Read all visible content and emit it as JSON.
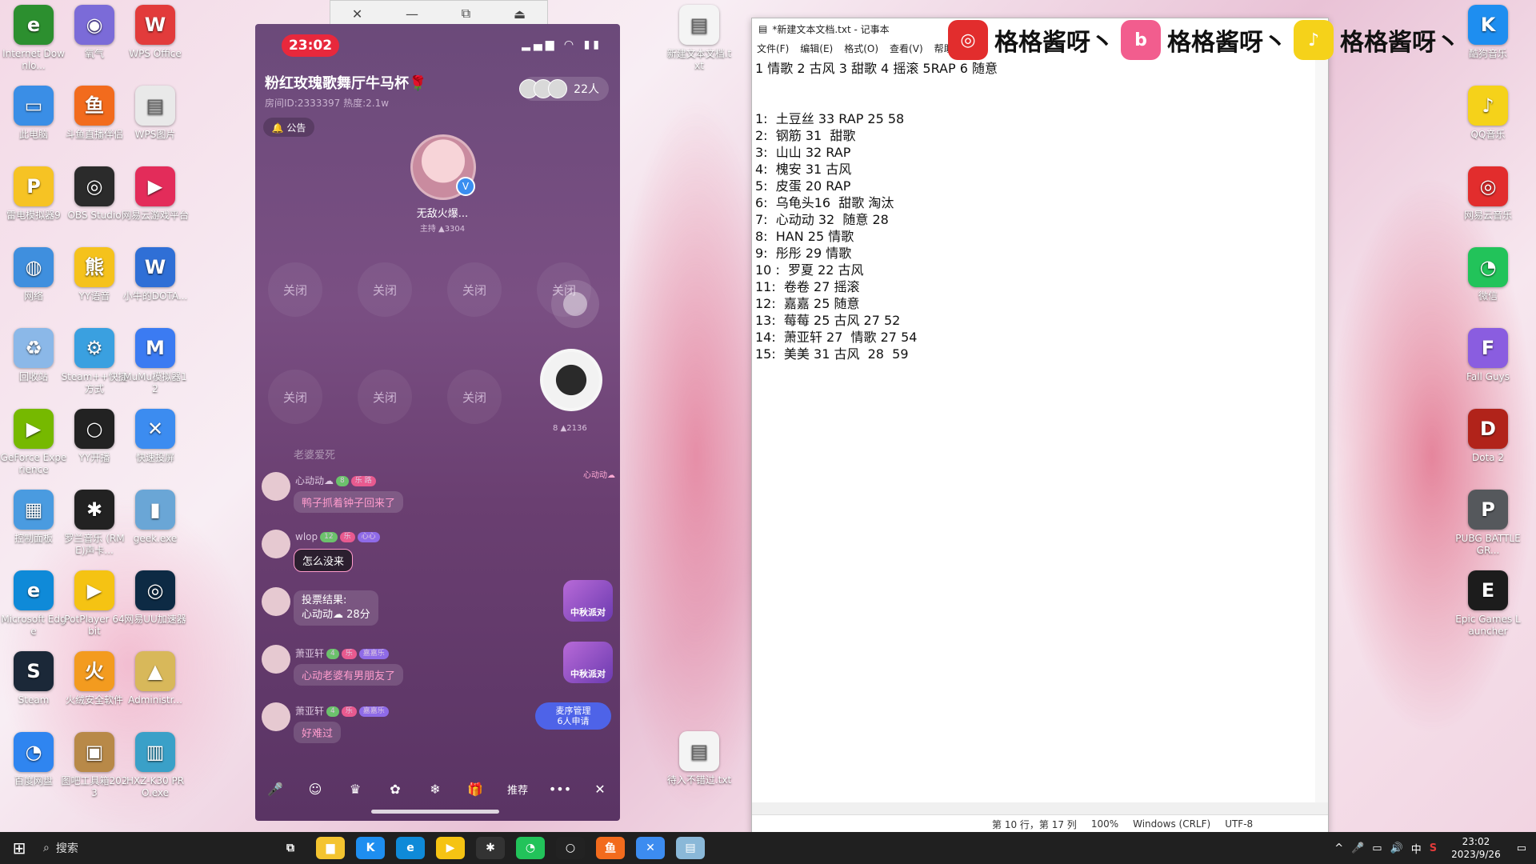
{
  "desktop": {
    "left_icons": [
      {
        "label": "Internet Downlo...",
        "glyph": "e",
        "color": "#2c8f2f"
      },
      {
        "label": "氧气",
        "glyph": "◉",
        "color": "#7b6bd8"
      },
      {
        "label": "WPS Office",
        "glyph": "W",
        "color": "#e23b3b"
      },
      {
        "label": "此电脑",
        "glyph": "▭",
        "color": "#3a8ee6"
      },
      {
        "label": "斗鱼直播伴侣",
        "glyph": "鱼",
        "color": "#f26b1d"
      },
      {
        "label": "WPS图片",
        "glyph": "▤",
        "color": "#e9e9e9"
      },
      {
        "label": "雷电模拟器9",
        "glyph": "P",
        "color": "#f6c324"
      },
      {
        "label": "OBS Studio",
        "glyph": "◎",
        "color": "#2b2b2b"
      },
      {
        "label": "网易云游戏平台",
        "glyph": "▶",
        "color": "#e32c5a"
      },
      {
        "label": "网络",
        "glyph": "◍",
        "color": "#3f8fde"
      },
      {
        "label": "YY语音",
        "glyph": "熊",
        "color": "#f5c21c"
      },
      {
        "label": "小牛的DOTA...",
        "glyph": "W",
        "color": "#2f6fd6"
      },
      {
        "label": "回收站",
        "glyph": "♻",
        "color": "#8bb8e8"
      },
      {
        "label": "Steam++快捷方式",
        "glyph": "⚙",
        "color": "#3aa0e0"
      },
      {
        "label": "MuMu模拟器12",
        "glyph": "M",
        "color": "#3b7bf2"
      },
      {
        "label": "GeForce Experience",
        "glyph": "▶",
        "color": "#76b900"
      },
      {
        "label": "YY开播",
        "glyph": "○",
        "color": "#222222"
      },
      {
        "label": "快速投屏",
        "glyph": "✕",
        "color": "#3c8cf0"
      },
      {
        "label": "控制面板",
        "glyph": "▦",
        "color": "#4a9be0"
      },
      {
        "label": "罗兰音乐 (RME)声卡...",
        "glyph": "✱",
        "color": "#222222"
      },
      {
        "label": "geek.exe",
        "glyph": "▮",
        "color": "#6aa6d6"
      },
      {
        "label": "Microsoft Edge",
        "glyph": "e",
        "color": "#0f8ad8"
      },
      {
        "label": "PotPlayer 64 bit",
        "glyph": "▶",
        "color": "#f5c313"
      },
      {
        "label": "网易UU加速器",
        "glyph": "◎",
        "color": "#0d2a44"
      },
      {
        "label": "Steam",
        "glyph": "S",
        "color": "#1b2838"
      },
      {
        "label": "火绒安全软件",
        "glyph": "火",
        "color": "#f39b1f"
      },
      {
        "label": "Administr...",
        "glyph": "▲",
        "color": "#d8b85a"
      },
      {
        "label": "百度网盘",
        "glyph": "◔",
        "color": "#2f85f0"
      },
      {
        "label": "图吧工具箱2023",
        "glyph": "▣",
        "color": "#b88948"
      },
      {
        "label": "HXZ-K30 PRO.exe",
        "glyph": "▥",
        "color": "#3aa0c8"
      }
    ],
    "mid_icons": [
      {
        "label": "新建文本文档.txt",
        "glyph": "▤",
        "color": "#f4f4f4"
      },
      {
        "label": "待入不错过.txt",
        "glyph": "▤",
        "color": "#f4f4f4"
      }
    ],
    "right_icons": [
      {
        "label": "酷狗音乐",
        "glyph": "K",
        "color": "#1e8ef0"
      },
      {
        "label": "QQ音乐",
        "glyph": "♪",
        "color": "#f5d21a"
      },
      {
        "label": "网易云音乐",
        "glyph": "◎",
        "color": "#e22d2d"
      },
      {
        "label": "微信",
        "glyph": "◔",
        "color": "#22c35a"
      },
      {
        "label": "Fall Guys",
        "glyph": "F",
        "color": "#8a5de0"
      },
      {
        "label": "Dota 2",
        "glyph": "D",
        "color": "#b1231a"
      },
      {
        "label": "PUBG BATTLEGR...",
        "glyph": "P",
        "color": "#55585c"
      },
      {
        "label": "Epic Games Launcher",
        "glyph": "E",
        "color": "#1c1c1c"
      }
    ]
  },
  "phone": {
    "titlebar_icons": [
      "✕",
      "—",
      "⧉",
      "⏏"
    ],
    "time": "23:02",
    "status_icons": "▂▄▆ ◠ ▮▮",
    "room_title": "粉红玫瑰歌舞厅牛马杯🌹",
    "room_sub": "房间ID:2333397 热度:2.1w",
    "online_count": "22人",
    "notice": "🔔 公告",
    "host_name": "无敌火爆...",
    "host_badge": "V",
    "host_meta": "主持 ▲3304",
    "seat_label": "关闭",
    "seat2_name": "心动动☁",
    "seat2_meta": "8 ▲2136",
    "faded_line": "老婆爱死",
    "messages": [
      {
        "nick": "心动动☁",
        "tags": [
          "8",
          "乐 路"
        ],
        "text": "鸭子抓着钟子回来了"
      },
      {
        "nick": "wlop",
        "tags": [
          "12",
          "乐",
          "心心"
        ],
        "text": "怎么没来"
      },
      {
        "nick": "",
        "tags": [],
        "text": "投票结果:\n心动动☁ 28分"
      },
      {
        "nick": "萧亚轩",
        "tags": [
          "4",
          "乐",
          "嘉嘉乐"
        ],
        "text": "心动老婆有男朋友了"
      },
      {
        "nick": "萧亚轩",
        "tags": [
          "4",
          "乐",
          "嘉嘉乐"
        ],
        "text": "好难过"
      }
    ],
    "party_label": "中秋派对",
    "queue_label": "麦序管理\n6人申请",
    "bottom_icons": [
      "🎤",
      "☺",
      "♛",
      "✿",
      "❄",
      "🎁",
      "推荐",
      "•••",
      "✕"
    ]
  },
  "notepad": {
    "title": "*新建文本文档.txt - 记事本",
    "menu": [
      "文件(F)",
      "编辑(E)",
      "格式(O)",
      "查看(V)",
      "帮助"
    ],
    "lines": [
      "1 情歌 2 古风 3 甜歌 4 摇滚 5RAP 6 随意",
      "",
      "",
      "1:  土豆丝 33 RAP 25 58",
      "2:  钢筋 31  甜歌",
      "3:  山山 32 RAP",
      "4:  槐安 31 古风",
      "5:  皮蛋 20 RAP",
      "6:  乌龟头16  甜歌 淘汰",
      "7:  心动动 32  随意 28",
      "8:  HAN 25 情歌",
      "9:  彤彤 29 情歌",
      "10 :  罗夏 22 古风",
      "11:  卷卷 27 摇滚",
      "12:  嘉嘉 25 随意",
      "13:  莓莓 25 古风 27 52",
      "14:  萧亚轩 27  情歌 27 54",
      "15:  美美 31 古风  28  59"
    ],
    "status": [
      "第 10 行，第 17 列",
      "100%",
      "Windows (CRLF)",
      "UTF-8"
    ]
  },
  "branding": {
    "name": "格格酱呀丶",
    "logos": [
      {
        "glyph": "◎",
        "color": "#e22d2d",
        "name": "netease-music"
      },
      {
        "glyph": "b",
        "color": "#f25d8e",
        "name": "bilibili"
      },
      {
        "glyph": "♪",
        "color": "#f5d21a",
        "name": "qq-music"
      }
    ]
  },
  "taskbar": {
    "search_placeholder": "搜索",
    "apps": [
      {
        "glyph": "⧉",
        "color": "#202020"
      },
      {
        "glyph": "▆",
        "color": "#f4c430"
      },
      {
        "glyph": "K",
        "color": "#1e8ef0"
      },
      {
        "glyph": "e",
        "color": "#0f8ad8"
      },
      {
        "glyph": "▶",
        "color": "#f5c313"
      },
      {
        "glyph": "✱",
        "color": "#333333"
      },
      {
        "glyph": "◔",
        "color": "#22c35a"
      },
      {
        "glyph": "○",
        "color": "#222222"
      },
      {
        "glyph": "鱼",
        "color": "#f26b1d"
      },
      {
        "glyph": "✕",
        "color": "#3c8cf0"
      },
      {
        "glyph": "▤",
        "color": "#8ab8d8"
      }
    ],
    "tray": [
      "^",
      "🎤",
      "▭",
      "🔊",
      "中",
      "S"
    ],
    "time": "23:02",
    "date": "2023/9/26"
  }
}
